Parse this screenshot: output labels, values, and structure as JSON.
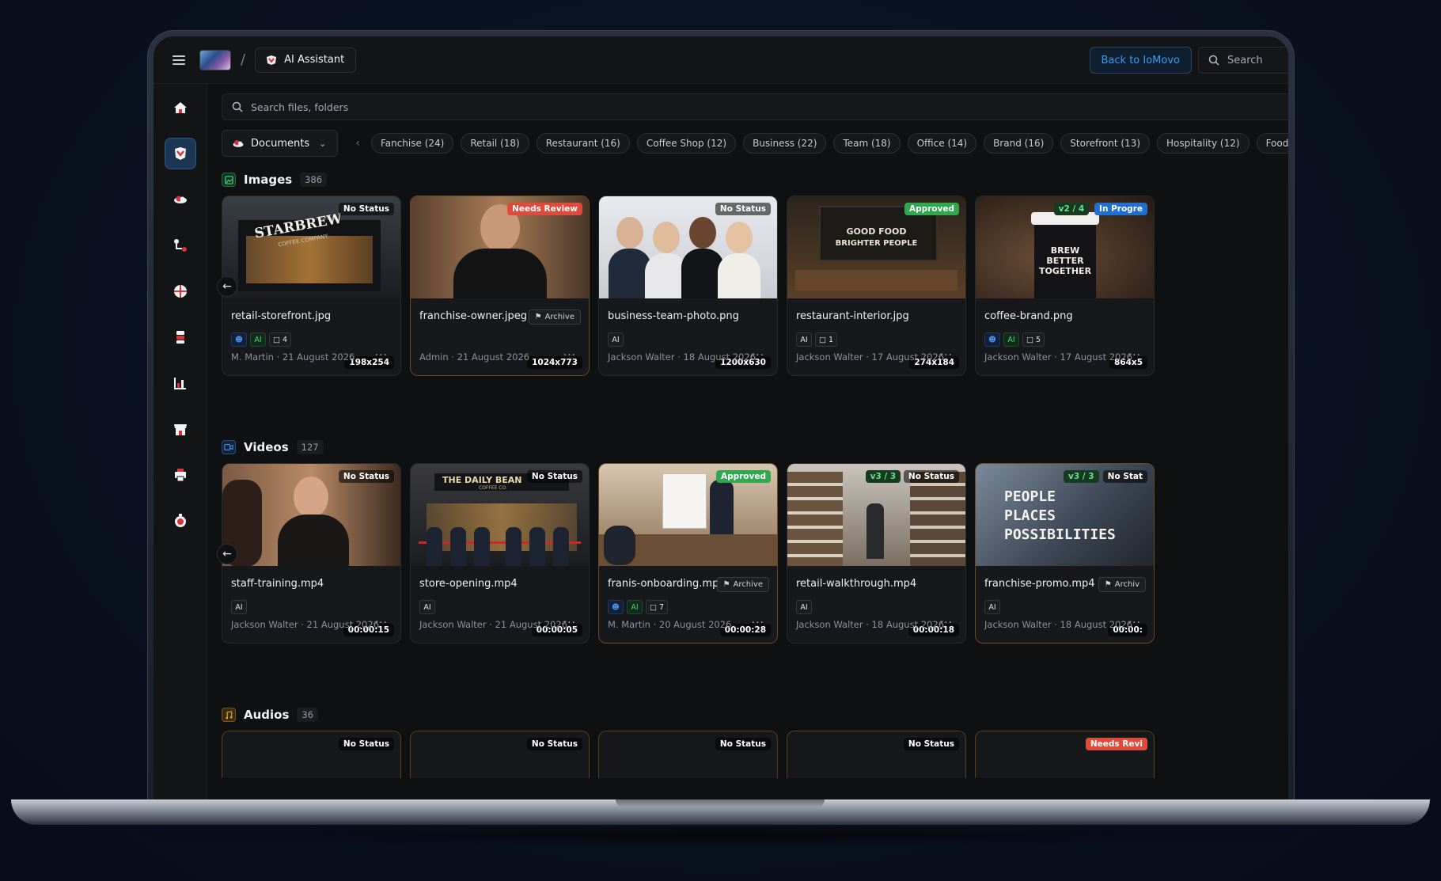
{
  "topbar": {
    "breadcrumb_sep": "/",
    "app_label": "AI Assistant",
    "back_label": "Back to IoMovo",
    "search_label": "Search"
  },
  "sidebar": {
    "items": [
      {
        "icon": "home-icon"
      },
      {
        "icon": "brand-library-icon",
        "active": true
      },
      {
        "icon": "cloud-icon"
      },
      {
        "icon": "workflow-icon"
      },
      {
        "icon": "globe-icon"
      },
      {
        "icon": "layers-icon"
      },
      {
        "icon": "analytics-icon"
      },
      {
        "icon": "store-icon"
      },
      {
        "icon": "print-icon"
      },
      {
        "icon": "timer-icon"
      }
    ]
  },
  "search": {
    "placeholder": "Search files, folders"
  },
  "filters": {
    "dropdown_label": "Documents",
    "chips": [
      "Fanchise (24)",
      "Retail (18)",
      "Restaurant (16)",
      "Coffee Shop (12)",
      "Business (22)",
      "Team (18)",
      "Office (14)",
      "Brand (16)",
      "Storefront (13)",
      "Hospitality (12)",
      "Food"
    ]
  },
  "colors": {
    "accent": "#3b9cf0",
    "review": "#e04a3a",
    "approved": "#2fa84f",
    "progress": "#1f6fd1"
  },
  "images": {
    "title": "Images",
    "count": "386",
    "cards": [
      {
        "name": "retail-storefront.jpg",
        "status": "No Status",
        "dims": "198x254",
        "tags": {
          "user": true,
          "ai": "AI",
          "comments": "4"
        },
        "meta": "M. Martin  ·  21 August 2026"
      },
      {
        "name": "franchise-owner.jpeg",
        "status": "Needs Review",
        "dims": "1024x773",
        "archive": "Archive",
        "meta": "Admin  ·  21 August 2026"
      },
      {
        "name": "business-team-photo.png",
        "status": "No Status",
        "dims": "1200x630",
        "tags": {
          "ai": "AI"
        },
        "meta": "Jackson Walter  ·  18 August 2026"
      },
      {
        "name": "restaurant-interior.jpg",
        "status": "Approved",
        "dims": "274x184",
        "tags": {
          "ai": "AI",
          "comments": "1"
        },
        "meta": "Jackson Walter  ·  17 August 2026"
      },
      {
        "name": "coffee-brand.png",
        "status": "In Progre",
        "version": "v2 / 4",
        "dims": "864x5",
        "tags": {
          "user": true,
          "ai": "AI",
          "comments": "5"
        },
        "meta": "Jackson Walter  ·  17 August 2026"
      }
    ],
    "thumb_text": {
      "storefront_sign": "STARBREW",
      "storefront_sub": "COFFEE COMPANY",
      "restaurant_line1": "GOOD FOOD",
      "restaurant_line2": "BRIGHTER PEOPLE",
      "cup_line1": "BREW",
      "cup_line2": "BETTER",
      "cup_line3": "TOGETHER"
    }
  },
  "videos": {
    "title": "Videos",
    "count": "127",
    "cards": [
      {
        "name": "staff-training.mp4",
        "status": "No Status",
        "duration": "00:00:15",
        "tags": {
          "ai": "AI"
        },
        "meta": "Jackson Walter  ·  21 August 2026"
      },
      {
        "name": "store-opening.mp4",
        "status": "No Status",
        "duration": "00:00:05",
        "tags": {
          "ai": "AI"
        },
        "meta": "Jackson Walter  ·  21 August 2026"
      },
      {
        "name": "franis-onboarding.mp4",
        "status": "Approved",
        "duration": "00:00:28",
        "archive": "Archive",
        "tags": {
          "user": true,
          "ai": "AI",
          "comments": "7"
        },
        "meta": "M. Martin  ·  20 August 2026"
      },
      {
        "name": "retail-walkthrough.mp4",
        "status": "No Status",
        "version": "v3 / 3",
        "duration": "00:00:18",
        "tags": {
          "ai": "AI"
        },
        "meta": "Jackson Walter  ·  18 August 2026"
      },
      {
        "name": "franchise-promo.mp4",
        "status": "No Stat",
        "version": "v3 / 3",
        "duration": "00:00:",
        "archive": "Archiv",
        "tags": {
          "ai": "AI"
        },
        "meta": "Jackson Walter  ·  18 August 2026"
      }
    ],
    "thumb_text": {
      "bean_sign": "THE DAILY BEAN",
      "bean_sub": "COFFEE CO.",
      "promo_line1": "PEOPLE",
      "promo_line2": "PLACES",
      "promo_line3": "POSSIBILITIES"
    }
  },
  "audios": {
    "title": "Audios",
    "count": "36",
    "cards": [
      {
        "status": "No Status"
      },
      {
        "status": "No Status"
      },
      {
        "status": "No Status"
      },
      {
        "status": "No Status"
      },
      {
        "status": "Needs Revi"
      }
    ]
  }
}
